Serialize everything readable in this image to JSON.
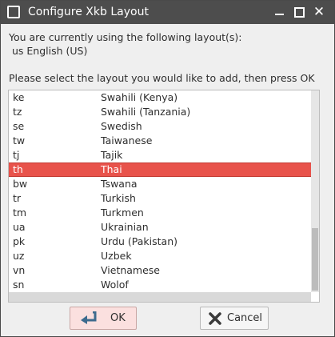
{
  "window": {
    "title": "Configure Xkb Layout",
    "minimize_icon": "minimize-icon",
    "maximize_icon": "maximize-icon",
    "close_glyph": "✕"
  },
  "intro": {
    "current_label": "You are currently using the following layout(s):",
    "current_layouts": "us English (US)",
    "instruction": "Please select the layout you would like to add, then press OK"
  },
  "layout_list": {
    "selected_index": 5,
    "rows": [
      {
        "code": "ke",
        "name": "Swahili (Kenya)"
      },
      {
        "code": "tz",
        "name": "Swahili (Tanzania)"
      },
      {
        "code": "se",
        "name": "Swedish"
      },
      {
        "code": "tw",
        "name": "Taiwanese"
      },
      {
        "code": "tj",
        "name": "Tajik"
      },
      {
        "code": "th",
        "name": "Thai"
      },
      {
        "code": "bw",
        "name": "Tswana"
      },
      {
        "code": "tr",
        "name": "Turkish"
      },
      {
        "code": "tm",
        "name": "Turkmen"
      },
      {
        "code": "ua",
        "name": "Ukrainian"
      },
      {
        "code": "pk",
        "name": "Urdu (Pakistan)"
      },
      {
        "code": "uz",
        "name": "Uzbek"
      },
      {
        "code": "vn",
        "name": "Vietnamese"
      },
      {
        "code": "sn",
        "name": "Wolof"
      }
    ]
  },
  "buttons": {
    "ok_label": "OK",
    "cancel_label": "Cancel"
  },
  "colors": {
    "selection": "#e8534b",
    "titlebar": "#4d4d4d",
    "ok_button": "#fbe0df"
  }
}
